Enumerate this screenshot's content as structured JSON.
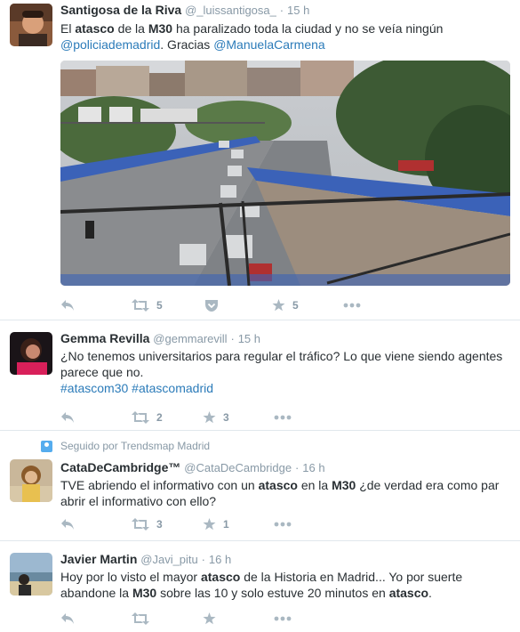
{
  "tweets": [
    {
      "fullname": "Santigosa de la Riva",
      "username": "@_luissantigosa_",
      "dot": "·",
      "time": "15 h",
      "text": {
        "p1": "El ",
        "k1": "atasco",
        "p2": " de la ",
        "k2": "M30",
        "p3": " ha paralizado toda la ciudad y no se veía ningún ",
        "m1": "@policiademadrid",
        "p4": ". Gracias ",
        "m2": "@ManuelaCarmena"
      },
      "retweets": "5",
      "favorites": "5"
    },
    {
      "fullname": "Gemma Revilla",
      "username": "@gemmarevill",
      "dot": "·",
      "time": "15 h",
      "text": {
        "p1": "¿No tenemos universitarios para regular el tráfico? Lo que viene siendo agentes parece que no.",
        "h1": "#atascom30",
        "sp": " ",
        "h2": "#atascomadrid"
      },
      "retweets": "2",
      "favorites": "3"
    },
    {
      "context": "Seguido por Trendsmap Madrid",
      "fullname": "CataDeCambridge™",
      "username": "@CataDeCambridge",
      "dot": "·",
      "time": "16 h",
      "text": {
        "p1": "TVE abriendo el informativo con un ",
        "k1": "atasco",
        "p2": " en la ",
        "k2": "M30",
        "p3": " ¿de verdad era como par abrir el informativo con ello?"
      },
      "retweets": "3",
      "favorites": "1"
    },
    {
      "fullname": "Javier Martin",
      "username": "@Javi_pitu",
      "dot": "·",
      "time": "16 h",
      "text": {
        "p1": "Hoy por lo visto el mayor ",
        "k1": "atasco",
        "p2": " de la Historia en Madrid... Yo por suerte abandone la ",
        "k2": "M30",
        "p3": " sobre las 10 y solo estuve 20 minutos en ",
        "k3": "atasco",
        "p4": "."
      }
    }
  ],
  "icons": {
    "reply": "reply-icon",
    "retweet": "retweet-icon",
    "favorite": "star-icon",
    "pocket": "pocket-icon",
    "more": "more-icon",
    "context": "person-icon"
  },
  "colors": {
    "link": "#2b7bb9",
    "muted": "#8899a6",
    "icon": "#aab8c2",
    "divider": "#e1e8ed",
    "context_icon": "#55acee"
  }
}
